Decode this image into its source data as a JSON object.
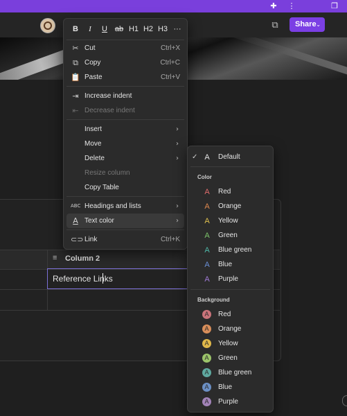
{
  "titlebar": {
    "puzzle_icon": "puzzle-icon",
    "more_icon": "more-vertical-icon",
    "restore_icon": "restore-icon"
  },
  "toolbar": {
    "share_label": "Share",
    "share_chevron": "⌄"
  },
  "format_bar": {
    "bold": "B",
    "italic": "I",
    "underline": "U",
    "strike": "ab",
    "h1": "H1",
    "h2": "H2",
    "h3": "H3",
    "more": "···"
  },
  "menu": {
    "cut": {
      "label": "Cut",
      "shortcut": "Ctrl+X"
    },
    "copy": {
      "label": "Copy",
      "shortcut": "Ctrl+C"
    },
    "paste": {
      "label": "Paste",
      "shortcut": "Ctrl+V"
    },
    "increase_indent": "Increase indent",
    "decrease_indent": "Decrease indent",
    "insert": "Insert",
    "move": "Move",
    "delete": "Delete",
    "resize_column": "Resize column",
    "copy_table": "Copy Table",
    "headings_lists": "Headings and lists",
    "text_color": "Text color",
    "link": {
      "label": "Link",
      "shortcut": "Ctrl+K"
    }
  },
  "text_color_menu": {
    "default": "Default",
    "color_header": "Color",
    "colors": [
      {
        "name": "Red",
        "hex": "#e06c6c"
      },
      {
        "name": "Orange",
        "hex": "#e0894f"
      },
      {
        "name": "Yellow",
        "hex": "#e0c04f"
      },
      {
        "name": "Green",
        "hex": "#7cc36a"
      },
      {
        "name": "Blue green",
        "hex": "#4fb8a8"
      },
      {
        "name": "Blue",
        "hex": "#6a8fd6"
      },
      {
        "name": "Purple",
        "hex": "#a07ad6"
      }
    ],
    "background_header": "Background",
    "backgrounds": [
      {
        "name": "Red",
        "hex": "#c9737a"
      },
      {
        "name": "Orange",
        "hex": "#d98e5a"
      },
      {
        "name": "Yellow",
        "hex": "#e0b84a"
      },
      {
        "name": "Green",
        "hex": "#9cc46a"
      },
      {
        "name": "Blue green",
        "hex": "#5fa9a0"
      },
      {
        "name": "Blue",
        "hex": "#6b8fc4"
      },
      {
        "name": "Purple",
        "hex": "#a283b8"
      }
    ],
    "letter": "A"
  },
  "table": {
    "column2_label": "Column 2",
    "cell_text": "Reference Links"
  }
}
